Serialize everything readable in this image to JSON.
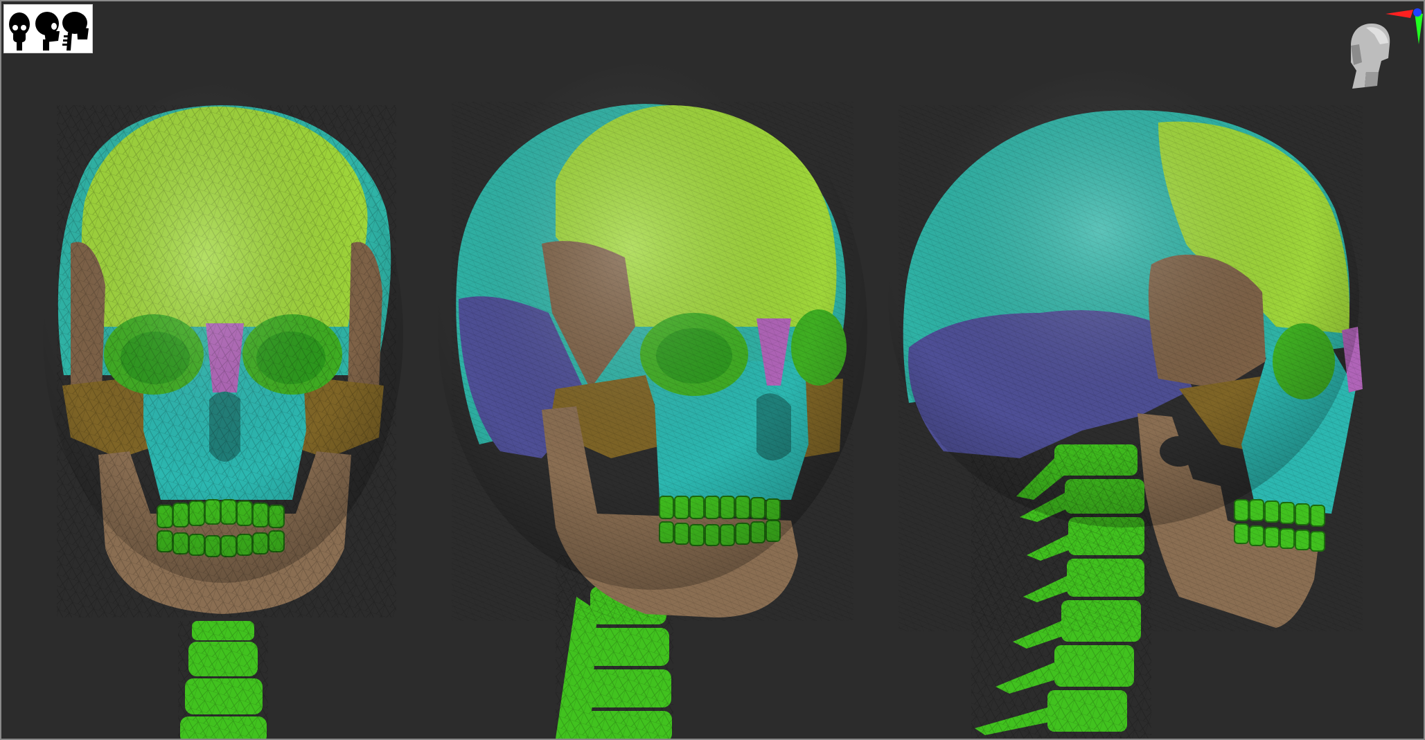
{
  "viewport": {
    "background": "#2c2c2c",
    "frame_color": "#8a8a8a"
  },
  "thumbnail_toolbar": {
    "icons": [
      "skull-front-silhouette-icon",
      "skull-three-quarter-silhouette-icon",
      "skull-side-silhouette-icon"
    ],
    "icon_color": "#000000",
    "background": "#ffffff"
  },
  "navigation_gizmo": {
    "icon": "head-orientation-gizmo-icon",
    "axis_colors": {
      "x": "#ff2020",
      "y": "#20ff20",
      "z": "#2040ff"
    }
  },
  "models": [
    {
      "name": "skull-front-view"
    },
    {
      "name": "skull-three-quarter-view"
    },
    {
      "name": "skull-side-view"
    }
  ],
  "palette": {
    "frontal": "#9fd63a",
    "parietal": "#2fb3a6",
    "temporal": "#4e4f96",
    "sphenoid": "#7e6247",
    "zygomatic": "#7f6526",
    "nasal": "#b064b8",
    "maxilla": "#2cb7b0",
    "mandible": "#8a6e52",
    "teeth_and_spine": "#41c21f"
  }
}
